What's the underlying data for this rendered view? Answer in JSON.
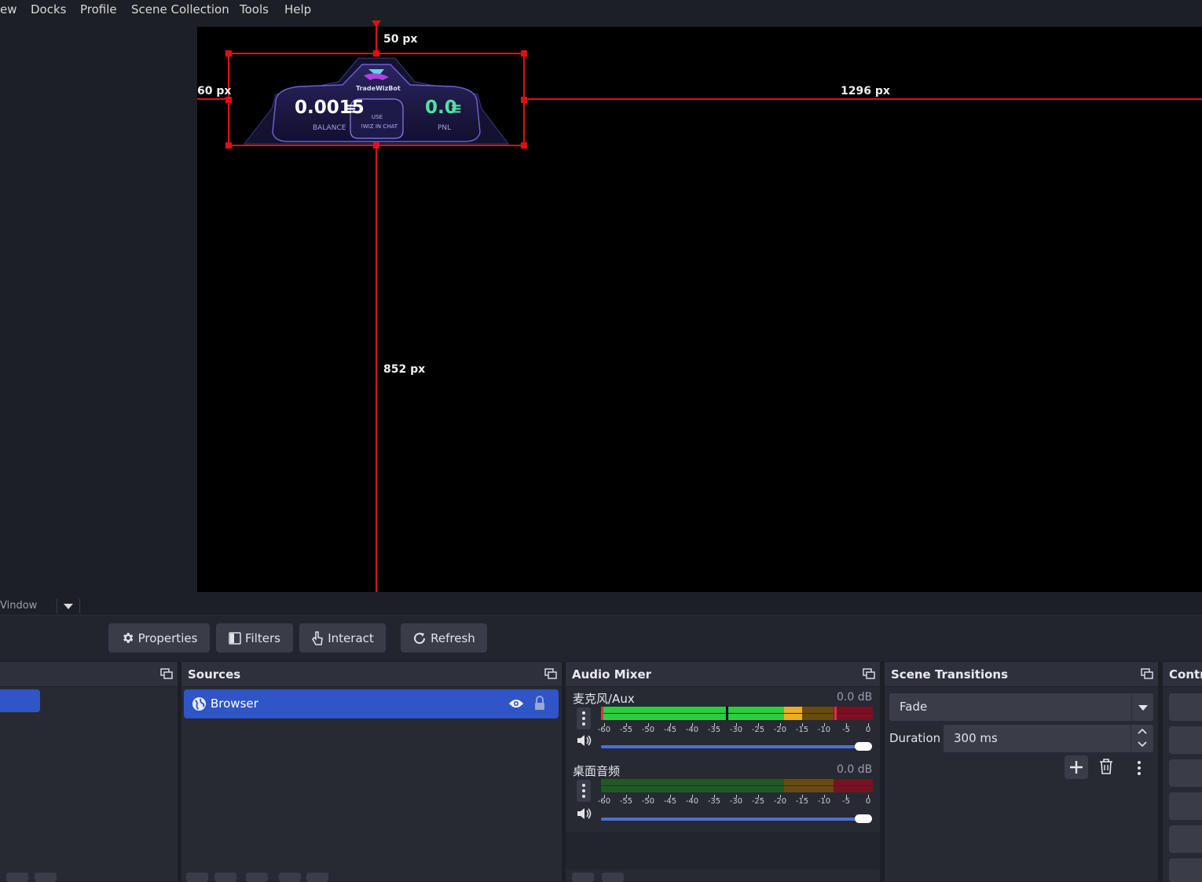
{
  "menu": [
    "ew",
    "Docks",
    "Profile",
    "Scene Collection",
    "Tools",
    "Help"
  ],
  "preview": {
    "dims": {
      "top": "50 px",
      "left": "60 px",
      "right": "1296 px",
      "bottom": "852 px"
    },
    "widget": {
      "brand": "TradeWizBot",
      "balance_value": "0.0015",
      "balance_label": "BALANCE",
      "center_line1": "USE",
      "center_line2": "!WIZ IN CHAT",
      "pnl_value": "0.0",
      "pnl_label": "PNL"
    }
  },
  "context_bar": {
    "label": "Vindow"
  },
  "toolbar": {
    "properties": "Properties",
    "filters": "Filters",
    "interact": "Interact",
    "refresh": "Refresh"
  },
  "sources": {
    "title": "Sources",
    "items": [
      {
        "label": "Browser"
      }
    ]
  },
  "audio_mixer": {
    "title": "Audio Mixer",
    "ticks": [
      "-60",
      "-55",
      "-50",
      "-45",
      "-40",
      "-35",
      "-30",
      "-25",
      "-20",
      "-15",
      "-10",
      "-5",
      "0"
    ],
    "channels": [
      {
        "name": "麦克风/Aux",
        "db": "0.0 dB",
        "level_db": -35
      },
      {
        "name": "桌面音频",
        "db": "0.0 dB",
        "level_db": -60
      }
    ]
  },
  "scene_transitions": {
    "title": "Scene Transitions",
    "transition": "Fade",
    "duration_label": "Duration",
    "duration_value": "300 ms"
  },
  "controls": {
    "title": "Contr"
  },
  "colors": {
    "selection": "#2f55c6",
    "accent_red": "#e01010",
    "meter_green": "#2ecc40",
    "meter_yellow": "#e8b020",
    "meter_red": "#c81e28"
  }
}
